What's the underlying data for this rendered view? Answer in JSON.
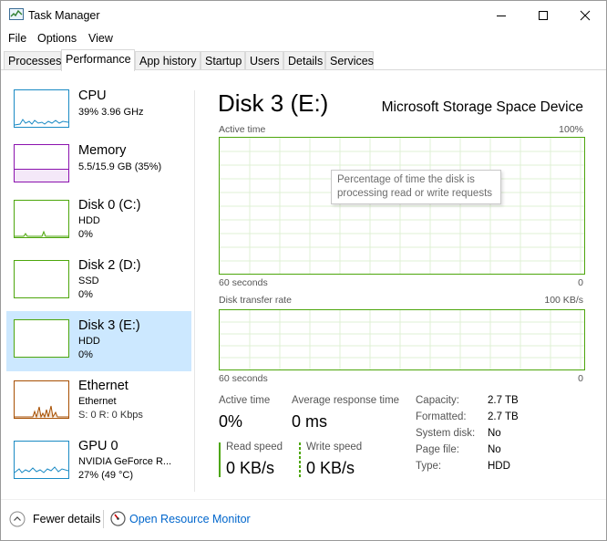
{
  "window": {
    "title": "Task Manager"
  },
  "menu": {
    "items": [
      "File",
      "Options",
      "View"
    ]
  },
  "tabs": [
    "Processes",
    "Performance",
    "App history",
    "Startup",
    "Users",
    "Details",
    "Services"
  ],
  "sidebar": {
    "items": [
      {
        "title": "CPU",
        "line1": "39%  3.96 GHz",
        "color": "#1a8ac4"
      },
      {
        "title": "Memory",
        "line1": "5.5/15.9 GB (35%)",
        "color": "#8b12ae"
      },
      {
        "title": "Disk 0 (C:)",
        "line1": "HDD",
        "line2": "0%",
        "color": "#4da60c"
      },
      {
        "title": "Disk 2 (D:)",
        "line1": "SSD",
        "line2": "0%",
        "color": "#4da60c"
      },
      {
        "title": "Disk 3 (E:)",
        "line1": "HDD",
        "line2": "0%",
        "color": "#4da60c"
      },
      {
        "title": "Ethernet",
        "line1": "Ethernet",
        "line2": "S: 0  R: 0 Kbps",
        "color": "#a74f01"
      },
      {
        "title": "GPU 0",
        "line1": "NVIDIA GeForce R...",
        "line2": "27%  (49 °C)",
        "color": "#1a8ac4"
      }
    ]
  },
  "main": {
    "title": "Disk 3 (E:)",
    "device": "Microsoft Storage Space Device",
    "active_graph": {
      "label": "Active time",
      "max": "100%",
      "time": "60 seconds",
      "min": "0"
    },
    "tooltip": {
      "line1": "Percentage of time the disk is",
      "line2": "processing read or write requests"
    },
    "transfer_graph": {
      "label": "Disk transfer rate",
      "max": "100 KB/s",
      "time": "60 seconds",
      "min": "0"
    },
    "stats": {
      "active_time": {
        "label": "Active time",
        "value": "0%"
      },
      "avg_response": {
        "label": "Average response time",
        "value": "0 ms"
      },
      "read_speed": {
        "label": "Read speed",
        "value": "0 KB/s"
      },
      "write_speed": {
        "label": "Write speed",
        "value": "0 KB/s"
      }
    },
    "properties": [
      {
        "label": "Capacity:",
        "value": "2.7 TB"
      },
      {
        "label": "Formatted:",
        "value": "2.7 TB"
      },
      {
        "label": "System disk:",
        "value": "No"
      },
      {
        "label": "Page file:",
        "value": "No"
      },
      {
        "label": "Type:",
        "value": "HDD"
      }
    ]
  },
  "bottom": {
    "fewer_details": "Fewer details",
    "open_monitor": "Open Resource Monitor"
  },
  "colors": {
    "disk_green": "#4da60c",
    "selected_bg": "#cce8ff",
    "link_blue": "#0066cc"
  }
}
